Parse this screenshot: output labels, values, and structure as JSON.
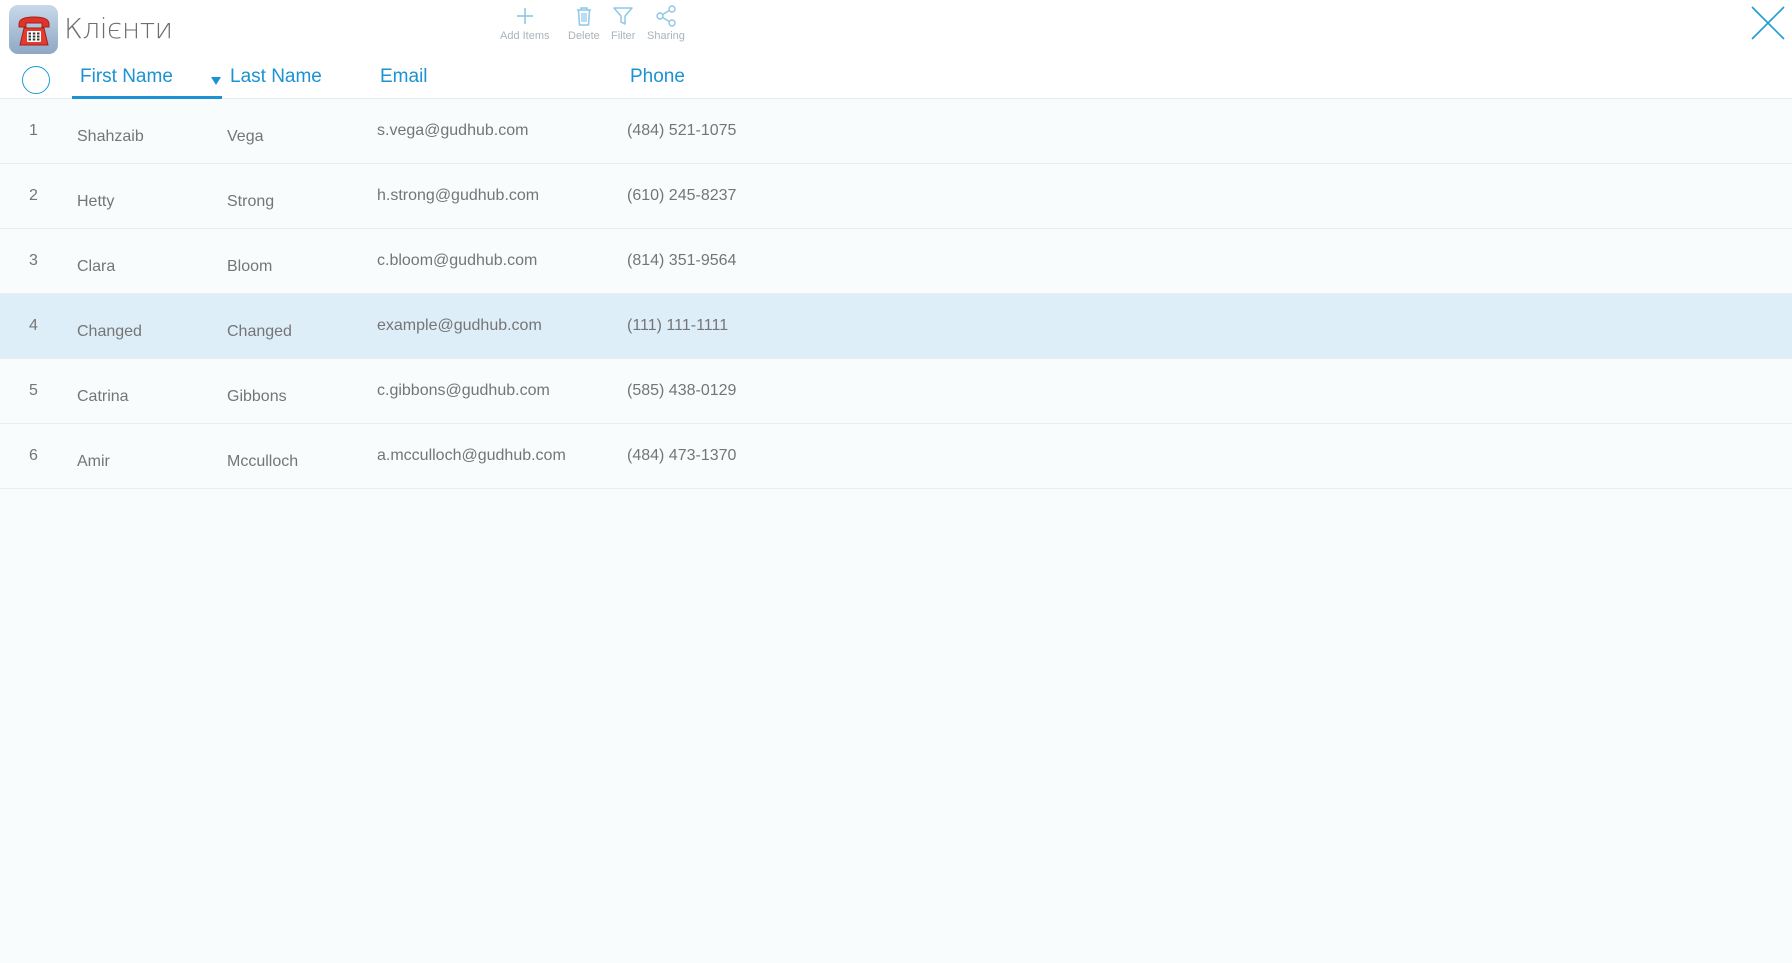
{
  "app": {
    "title": "Клієнти",
    "icon": "telephone-icon"
  },
  "toolbar": {
    "add_label": "Add Items",
    "delete_label": "Delete",
    "filter_label": "Filter",
    "sharing_label": "Sharing"
  },
  "table": {
    "columns": {
      "first_name": "First Name",
      "last_name": "Last Name",
      "email": "Email",
      "phone": "Phone"
    },
    "sort": {
      "column": "first_name",
      "direction": "descending"
    },
    "rows": [
      {
        "num": "1",
        "first": "Shahzaib",
        "last": "Vega",
        "email": "s.vega@gudhub.com",
        "phone": "(484) 521-1075"
      },
      {
        "num": "2",
        "first": "Hetty",
        "last": "Strong",
        "email": "h.strong@gudhub.com",
        "phone": "(610) 245-8237"
      },
      {
        "num": "3",
        "first": "Clara",
        "last": "Bloom",
        "email": "c.bloom@gudhub.com",
        "phone": "(814) 351-9564"
      },
      {
        "num": "4",
        "first": "Changed",
        "last": "Changed",
        "email": "example@gudhub.com",
        "phone": "(111) 111-1111"
      },
      {
        "num": "5",
        "first": "Catrina",
        "last": "Gibbons",
        "email": "c.gibbons@gudhub.com",
        "phone": "(585) 438-0129"
      },
      {
        "num": "6",
        "first": "Amir",
        "last": "Mcculloch",
        "email": "a.mcculloch@gudhub.com",
        "phone": "(484) 473-1370"
      }
    ],
    "selected_row": "4"
  },
  "colors": {
    "accent": "#1c92d2",
    "selected_row_bg": "#deeef9",
    "page_bg": "#f9fcfd"
  }
}
